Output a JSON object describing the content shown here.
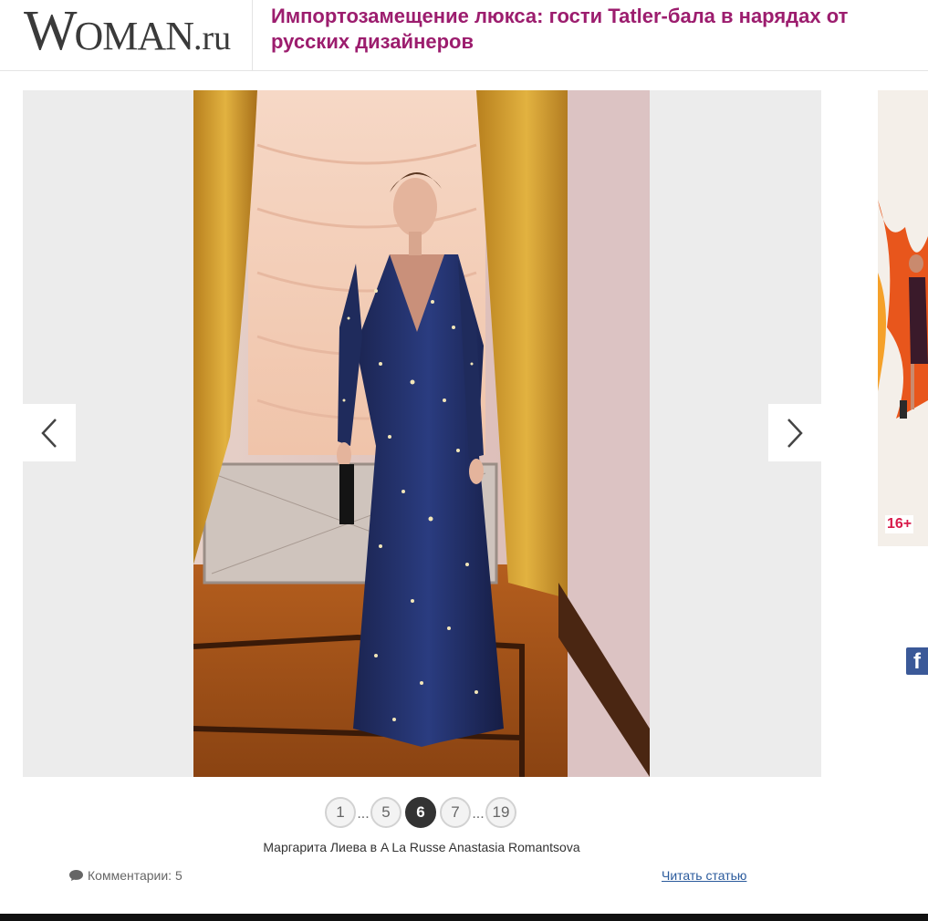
{
  "header": {
    "logo": {
      "w": "W",
      "main": "OMAN",
      "ru": ".ru"
    },
    "headline": "Импортозамещение люкса: гости Tatler-бала в нарядах от русских дизайнеров"
  },
  "gallery": {
    "prev_icon": "chevron-left-icon",
    "next_icon": "chevron-right-icon"
  },
  "side_ad": {
    "age_rating": "16+"
  },
  "social": {
    "facebook_label": "f"
  },
  "pagination": {
    "pages": [
      "1",
      "5",
      "6",
      "7",
      "19"
    ],
    "current": "6",
    "ellipsis": "..."
  },
  "caption": "Маргарита Лиева в A La Russe Anastasia Romantsova",
  "footer": {
    "comments_label": "Комментарии: 5",
    "read_article": "Читать статью"
  },
  "colors": {
    "headline": "#9c1d6e",
    "active_page": "#333333",
    "link": "#2a5a9c",
    "facebook": "#3b5998"
  }
}
